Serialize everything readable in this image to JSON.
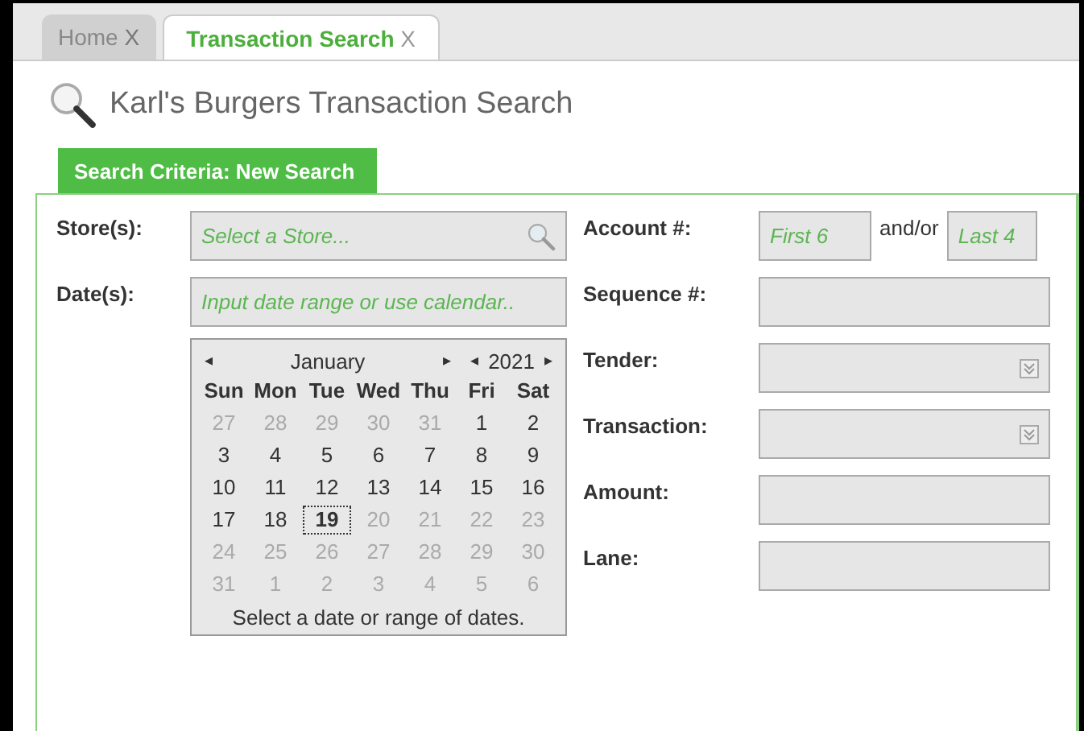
{
  "tabs": [
    {
      "label": "Home",
      "close": "X",
      "selected": false
    },
    {
      "label": "Transaction Search",
      "close": "X",
      "selected": true
    }
  ],
  "page_title": "Karl's Burgers Transaction Search",
  "section_tab": "Search Criteria: New Search",
  "left_fields": [
    {
      "label": "Store(s):",
      "kind": "search",
      "placeholder": "Select a Store..."
    },
    {
      "label": "Date(s):",
      "kind": "text",
      "placeholder": "Input date range or use calendar.."
    }
  ],
  "calendar": {
    "prev": "◂",
    "month": "January",
    "next": "▸",
    "year_prev": "◂",
    "year": "2021",
    "year_next": "▸",
    "weekdays": [
      "Sun",
      "Mon",
      "Tue",
      "Wed",
      "Thu",
      "Fri",
      "Sat"
    ],
    "weeks": [
      [
        {
          "day": "27",
          "muted": true,
          "selected": false
        },
        {
          "day": "28",
          "muted": true,
          "selected": false
        },
        {
          "day": "29",
          "muted": true,
          "selected": false
        },
        {
          "day": "30",
          "muted": true,
          "selected": false
        },
        {
          "day": "31",
          "muted": true,
          "selected": false
        },
        {
          "day": "1",
          "muted": false,
          "selected": false
        },
        {
          "day": "2",
          "muted": false,
          "selected": false
        }
      ],
      [
        {
          "day": "3",
          "muted": false,
          "selected": false
        },
        {
          "day": "4",
          "muted": false,
          "selected": false
        },
        {
          "day": "5",
          "muted": false,
          "selected": false
        },
        {
          "day": "6",
          "muted": false,
          "selected": false
        },
        {
          "day": "7",
          "muted": false,
          "selected": false
        },
        {
          "day": "8",
          "muted": false,
          "selected": false
        },
        {
          "day": "9",
          "muted": false,
          "selected": false
        }
      ],
      [
        {
          "day": "10",
          "muted": false,
          "selected": false
        },
        {
          "day": "11",
          "muted": false,
          "selected": false
        },
        {
          "day": "12",
          "muted": false,
          "selected": false
        },
        {
          "day": "13",
          "muted": false,
          "selected": false
        },
        {
          "day": "14",
          "muted": false,
          "selected": false
        },
        {
          "day": "15",
          "muted": false,
          "selected": false
        },
        {
          "day": "16",
          "muted": false,
          "selected": false
        }
      ],
      [
        {
          "day": "17",
          "muted": false,
          "selected": false
        },
        {
          "day": "18",
          "muted": false,
          "selected": false
        },
        {
          "day": "19",
          "muted": false,
          "selected": true
        },
        {
          "day": "20",
          "muted": true,
          "selected": false
        },
        {
          "day": "21",
          "muted": true,
          "selected": false
        },
        {
          "day": "22",
          "muted": true,
          "selected": false
        },
        {
          "day": "23",
          "muted": true,
          "selected": false
        }
      ],
      [
        {
          "day": "24",
          "muted": true,
          "selected": false
        },
        {
          "day": "25",
          "muted": true,
          "selected": false
        },
        {
          "day": "26",
          "muted": true,
          "selected": false
        },
        {
          "day": "27",
          "muted": true,
          "selected": false
        },
        {
          "day": "28",
          "muted": true,
          "selected": false
        },
        {
          "day": "29",
          "muted": true,
          "selected": false
        },
        {
          "day": "30",
          "muted": true,
          "selected": false
        }
      ],
      [
        {
          "day": "31",
          "muted": true,
          "selected": false
        },
        {
          "day": "1",
          "muted": true,
          "selected": false
        },
        {
          "day": "2",
          "muted": true,
          "selected": false
        },
        {
          "day": "3",
          "muted": true,
          "selected": false
        },
        {
          "day": "4",
          "muted": true,
          "selected": false
        },
        {
          "day": "5",
          "muted": true,
          "selected": false
        },
        {
          "day": "6",
          "muted": true,
          "selected": false
        }
      ]
    ],
    "hint": "Select a date or range of dates."
  },
  "right_fields": [
    {
      "label": "Account #:",
      "kind": "split",
      "first_placeholder": "First 6",
      "joiner": "and/or",
      "last_placeholder": "Last 4"
    },
    {
      "label": "Sequence #:",
      "kind": "text"
    },
    {
      "label": "Tender:",
      "kind": "dropdown"
    },
    {
      "label": "Transaction:",
      "kind": "dropdown"
    },
    {
      "label": "Amount:",
      "kind": "text"
    },
    {
      "label": "Lane:",
      "kind": "text"
    }
  ]
}
